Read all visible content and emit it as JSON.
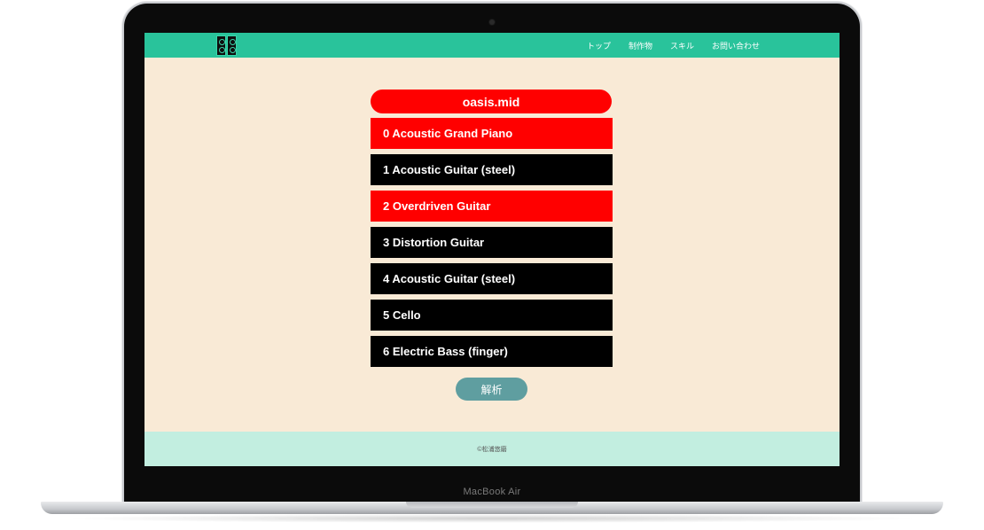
{
  "device": {
    "label": "MacBook Air"
  },
  "header": {
    "logo_icon": "speaker-pair-icon",
    "nav": [
      {
        "label": "トップ"
      },
      {
        "label": "制作物"
      },
      {
        "label": "スキル"
      },
      {
        "label": "お問い合わせ"
      }
    ],
    "accent_color": "#29c39b"
  },
  "main": {
    "file_name": "oasis.mid",
    "tracks": [
      {
        "label": "0 Acoustic Grand Piano",
        "selected": true
      },
      {
        "label": "1 Acoustic Guitar (steel)",
        "selected": false
      },
      {
        "label": "2 Overdriven Guitar",
        "selected": true
      },
      {
        "label": "3 Distortion Guitar",
        "selected": false
      },
      {
        "label": "4 Acoustic Guitar (steel)",
        "selected": false
      },
      {
        "label": "5 Cello",
        "selected": false
      },
      {
        "label": "6 Electric Bass (finger)",
        "selected": false
      }
    ],
    "analyze_label": "解析",
    "selected_color": "#ff0000",
    "unselected_color": "#000000"
  },
  "footer": {
    "copyright": "©松浦悠磨"
  }
}
